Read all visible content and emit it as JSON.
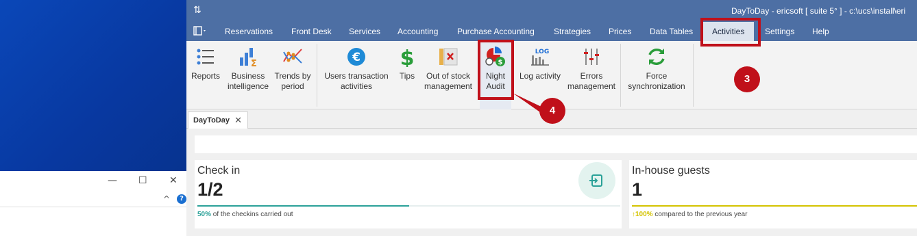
{
  "window": {
    "title": "DayToDay - ericsoft [ suite 5° ] - c:\\ucs\\install\\eri"
  },
  "menu": {
    "items": [
      {
        "label": "Reservations"
      },
      {
        "label": "Front Desk"
      },
      {
        "label": "Services"
      },
      {
        "label": "Accounting"
      },
      {
        "label": "Purchase Accounting"
      },
      {
        "label": "Strategies"
      },
      {
        "label": "Prices"
      },
      {
        "label": "Data Tables"
      },
      {
        "label": "Activities",
        "active": true
      },
      {
        "label": "Settings"
      },
      {
        "label": "Help"
      }
    ]
  },
  "ribbon": {
    "reports": "Reports",
    "bi_l1": "Business",
    "bi_l2": "intelligence",
    "trends_l1": "Trends by",
    "trends_l2": "period",
    "uta_l1": "Users transaction",
    "uta_l2": "activities",
    "tips": "Tips",
    "oos_l1": "Out of stock",
    "oos_l2": "management",
    "night_l1": "Night",
    "night_l2": "Audit",
    "log": "Log activity",
    "errors_l1": "Errors",
    "errors_l2": "management",
    "sync_l1": "Force",
    "sync_l2": "synchronization"
  },
  "annotations": {
    "marker3": "3",
    "marker4": "4",
    "color": "#c0101a"
  },
  "tab": {
    "label": "DayToDay"
  },
  "cards": {
    "checkin": {
      "title": "Check in",
      "value": "1/2",
      "progress": 0.5,
      "pct": "50%",
      "note": "of the checkins carried out",
      "accent": "#2aa198"
    },
    "inhouse": {
      "title": "In-house guests",
      "value": "1",
      "pct": "↑100%",
      "note": "compared to the previous year",
      "accent": "#d4c300"
    }
  }
}
